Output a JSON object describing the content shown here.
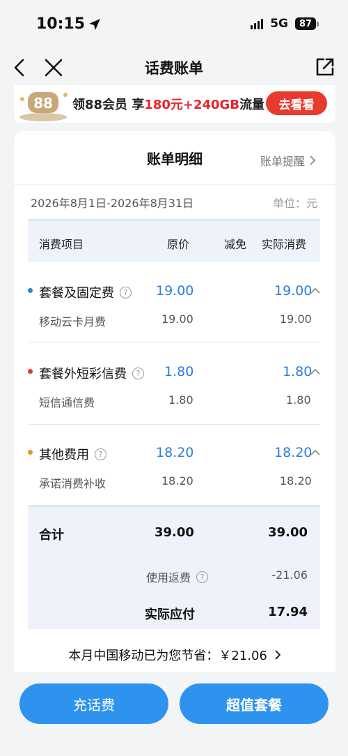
{
  "status_bar": {
    "time": "10:15",
    "network": "5G",
    "battery": "87"
  },
  "nav": {
    "title": "话费账单"
  },
  "banner": {
    "promo_prefix": "领88会员 享",
    "promo_highlight": "180元+240GB",
    "promo_suffix": "流量",
    "cta": "去看看",
    "logo_text": "88"
  },
  "card": {
    "title": "账单明细",
    "reminder": "账单提醒",
    "period": "2026年8月1日-2026年8月31日",
    "unit": "单位：元",
    "headers": {
      "item": "消费项目",
      "original": "原价",
      "discount": "减免",
      "actual": "实际消费"
    },
    "groups": [
      {
        "name": "套餐及固定费",
        "color": "#2a7de1",
        "original": "19.00",
        "actual": "19.00",
        "sub_name": "移动云卡月费",
        "sub_original": "19.00",
        "sub_actual": "19.00"
      },
      {
        "name": "套餐外短彩信费",
        "color": "#e5353b",
        "original": "1.80",
        "actual": "1.80",
        "sub_name": "短信通信费",
        "sub_original": "1.80",
        "sub_actual": "1.80"
      },
      {
        "name": "其他费用",
        "color": "#e8932a",
        "original": "18.20",
        "actual": "18.20",
        "sub_name": "承诺消费补收",
        "sub_original": "18.20",
        "sub_actual": "18.20"
      }
    ],
    "total": {
      "label": "合计",
      "original": "39.00",
      "actual": "39.00",
      "rebate_label": "使用返费",
      "rebate_value": "-21.06",
      "pay_label": "实际应付",
      "pay_value": "17.94"
    },
    "savings": "本月中国移动已为您节省：￥21.06"
  },
  "buttons": {
    "recharge": "充话费",
    "plan": "超值套餐"
  },
  "icons": {
    "back": "chevron-left-icon",
    "close": "close-icon",
    "share": "share-icon",
    "help": "question-circle-icon",
    "collapse": "chevron-up-icon"
  }
}
